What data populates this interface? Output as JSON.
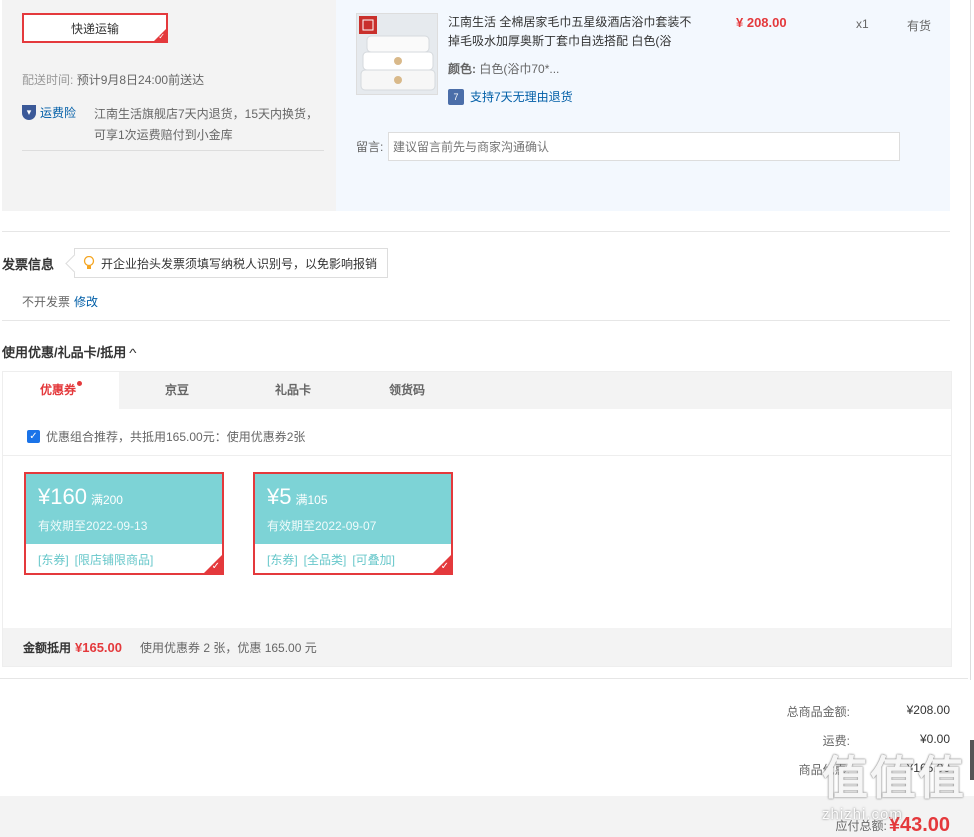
{
  "shipping": {
    "method": "快递运输",
    "delivery_label": "配送时间:",
    "delivery_value": "预计9月8日24:00前送达",
    "insurance_label": "运费险",
    "insurance_text": "江南生活旗舰店7天内退货，15天内换货，可享1次运费赔付到小金库"
  },
  "product": {
    "brand_badge": "江南生活",
    "title": "江南生活 全棉居家毛巾五星级酒店浴巾套装不掉毛吸水加厚奥斯丁套巾自选搭配 白色(浴",
    "price": "¥ 208.00",
    "qty": "x1",
    "stock": "有货",
    "color_label": "颜色:",
    "color_value": "白色(浴巾70*...",
    "return_icon": "7",
    "return_text": "支持7天无理由退货",
    "msg_label": "留言:",
    "msg_placeholder": "建议留言前先与商家沟通确认"
  },
  "invoice": {
    "title": "发票信息",
    "tip": "开企业抬头发票须填写纳税人识别号，以免影响报销",
    "status": "不开发票",
    "edit": "修改"
  },
  "coupons": {
    "title": "使用优惠/礼品卡/抵用",
    "tabs": [
      {
        "label": "优惠券"
      },
      {
        "label": "京豆"
      },
      {
        "label": "礼品卡"
      },
      {
        "label": "领货码"
      }
    ],
    "combo_text": "优惠组合推荐，共抵用165.00元：使用优惠券2张",
    "items": [
      {
        "amount": "¥160",
        "condition": "满200",
        "expiry": "有效期至2022-09-13",
        "tags": [
          "[东券]",
          "[限店铺限商品]"
        ]
      },
      {
        "amount": "¥5",
        "condition": "满105",
        "expiry": "有效期至2022-09-07",
        "tags": [
          "[东券]",
          "[全品类]",
          "[可叠加]"
        ]
      }
    ],
    "footer_label": "金额抵用",
    "footer_amount": "¥165.00",
    "footer_desc": "使用优惠券 2 张，优惠 165.00 元"
  },
  "summary": {
    "total_label": "总商品金额:",
    "total_value": "¥208.00",
    "freight_label": "运费:",
    "freight_value": "¥0.00",
    "discount_label": "商品优惠:",
    "discount_value": "-¥165.00",
    "pay_label": "应付总额:",
    "pay_value": "¥43.00"
  },
  "watermark": {
    "glyphs": "值值值",
    "url": "zhizhi.com"
  },
  "colors": {
    "accent": "#e4393c",
    "link": "#005ea7",
    "coupon": "#7dd3d6"
  }
}
